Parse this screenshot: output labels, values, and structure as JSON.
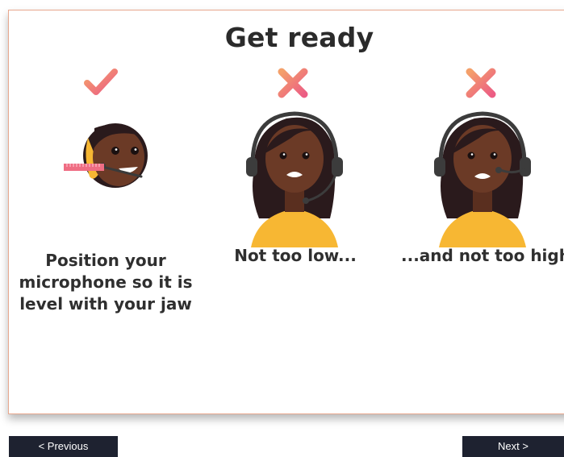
{
  "page": {
    "title": "Get ready"
  },
  "panels": [
    {
      "status": "correct",
      "status_icon": "checkmark-icon",
      "caption": "Position your microphone so it is level with your jaw"
    },
    {
      "status": "incorrect",
      "status_icon": "cross-icon",
      "caption": "Not too low..."
    },
    {
      "status": "incorrect",
      "status_icon": "cross-icon",
      "caption": "...and not too high"
    }
  ],
  "navigation": {
    "previous_label": "< Previous",
    "next_label": "Next >"
  },
  "colors": {
    "accent_pink": "#ef6d83",
    "accent_orange": "#f4a06a",
    "button_bg": "#1e2230",
    "frame_border": "#e8a88e",
    "skin": "#6b3a26",
    "hair": "#2a1a1c",
    "shirt": "#f7b733"
  }
}
